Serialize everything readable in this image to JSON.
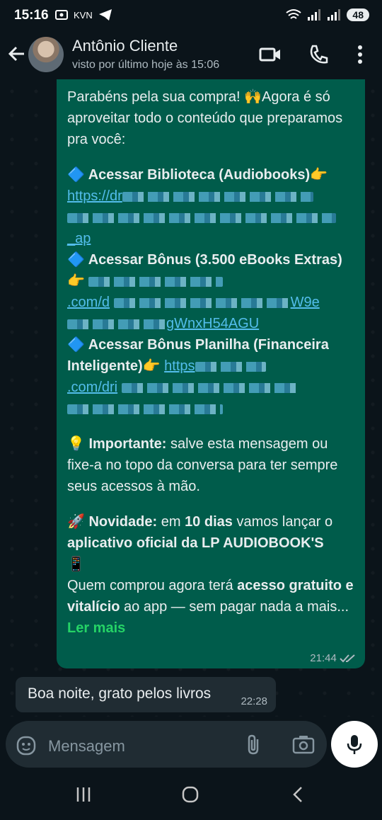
{
  "status_bar": {
    "time": "15:16",
    "battery": "48",
    "notif_icons": [
      "screen-record-icon",
      "kvn-icon",
      "telegram-icon"
    ],
    "kvn_label": "KVN"
  },
  "header": {
    "contact_name": "Antônio Cliente",
    "last_seen": "visto por último hoje às 15:06",
    "icons": [
      "back-arrow-icon",
      "video-call-icon",
      "phone-call-icon",
      "more-options-icon"
    ]
  },
  "messages": {
    "outgoing": {
      "intro": "Parabéns pela sua compra! 🙌Agora é só aproveitar todo o conteúdo que preparamos pra você:",
      "item1_label": "🔷 Acessar Biblioteca (Audiobooks)👉",
      "item1_link_partial": "https://dr",
      "item1_link_end": "_ap",
      "item2_label": "🔷 Acessar Bônus (3.500 eBooks Extras)👉",
      "item2_link_partial": ".com/d",
      "item2_link_mid": "W9e",
      "item2_link_end": "gWnxH54AGU",
      "item3_label": "🔷 Acessar Bônus Planilha (Financeira Inteligente)👉",
      "item3_link_partial": "https",
      "item3_link_mid": ".com/dri",
      "important_label": "💡 Importante:",
      "important_text": "salve esta mensagem ou fixe-a no topo da conversa para ter sempre seus acessos à mão.",
      "novidade_label": "🚀 Novidade:",
      "novidade_pre": "em",
      "novidade_days": "10 dias",
      "novidade_mid": "vamos lançar o",
      "novidade_app": "aplicativo oficial da LP AUDIOBOOK'S",
      "novidade_emoji": "📱",
      "buyers_pre": "Quem comprou agora terá",
      "buyers_bold": "acesso gratuito e vitalício",
      "buyers_post": "ao app — sem pagar nada a mais...",
      "read_more": "Ler mais",
      "time": "21:44"
    },
    "incoming": {
      "text": "Boa noite, grato pelos livros",
      "time": "22:28"
    }
  },
  "composer": {
    "placeholder": "Mensagem",
    "icons": [
      "emoji-sticker-icon",
      "attach-icon",
      "camera-icon",
      "mic-icon"
    ]
  },
  "navigation": {
    "icons": [
      "recent-apps-icon",
      "home-icon",
      "back-icon"
    ]
  },
  "colors": {
    "background": "#0b141a",
    "outgoing_bubble": "#005c4b",
    "incoming_bubble": "#202c33",
    "link": "#53bdeb",
    "read_more": "#25d366"
  }
}
